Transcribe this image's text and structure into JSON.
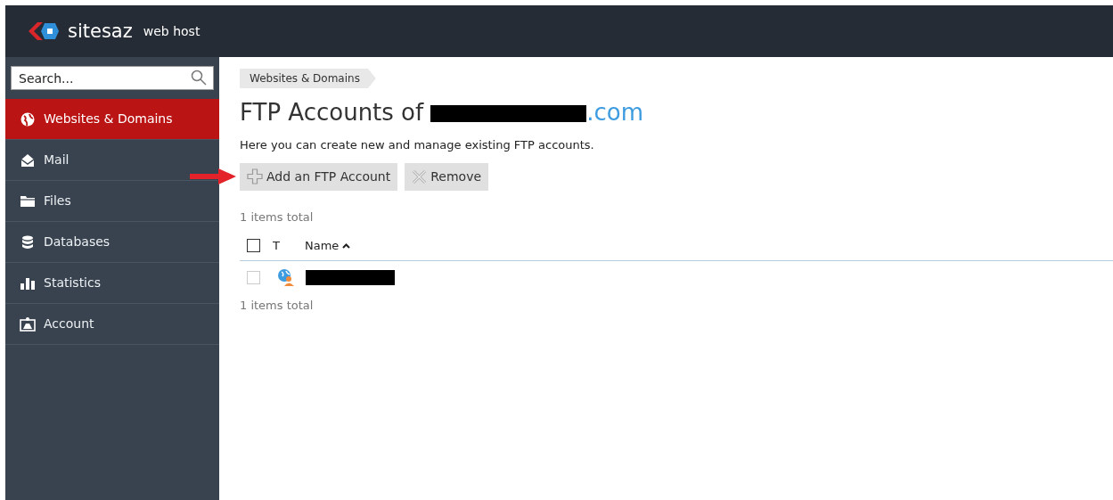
{
  "header": {
    "brand": "sitesaz",
    "tagline": "web host"
  },
  "sidebar": {
    "search": {
      "placeholder": "Search..."
    },
    "items": [
      {
        "label": "Websites & Domains",
        "kind": "globe",
        "selected": true
      },
      {
        "label": "Mail",
        "kind": "mail",
        "selected": false
      },
      {
        "label": "Files",
        "kind": "folder",
        "selected": false
      },
      {
        "label": "Databases",
        "kind": "database",
        "selected": false
      },
      {
        "label": "Statistics",
        "kind": "stats",
        "selected": false
      },
      {
        "label": "Account",
        "kind": "account",
        "selected": false
      }
    ]
  },
  "breadcrumb": [
    "Websites & Domains"
  ],
  "page": {
    "title_prefix": "FTP Accounts of",
    "title_suffix": ".com",
    "description": "Here you can create new and manage existing FTP accounts."
  },
  "toolbar": [
    {
      "label": "Add an FTP Account",
      "kind": "add"
    },
    {
      "label": "Remove",
      "kind": "remove"
    }
  ],
  "list": {
    "total_top": "1 items total",
    "select_all": {
      "checked": false
    },
    "columns": [
      {
        "label": "T",
        "sorted": false
      },
      {
        "label": "Name",
        "sorted": true
      }
    ],
    "rows": [
      {
        "checked": false
      }
    ],
    "total_bottom": "1 items total"
  }
}
